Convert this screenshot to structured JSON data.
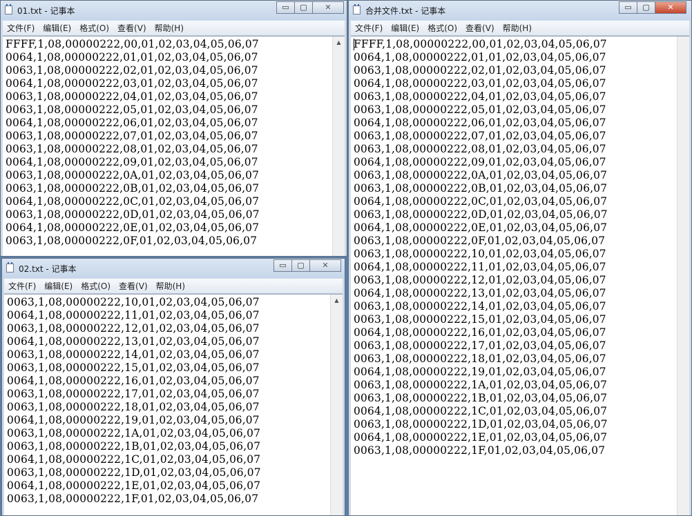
{
  "menu": [
    "文件(F)",
    "编辑(E)",
    "格式(O)",
    "查看(V)",
    "帮助(H)"
  ],
  "window_buttons": {
    "minimize": "▭",
    "maximize": "▢",
    "close": "✕"
  },
  "win1": {
    "title": "01.txt - 记事本",
    "lines": [
      "FFFF,1,08,00000222,00,01,02,03,04,05,06,07",
      "0064,1,08,00000222,01,01,02,03,04,05,06,07",
      "0063,1,08,00000222,02,01,02,03,04,05,06,07",
      "0064,1,08,00000222,03,01,02,03,04,05,06,07",
      "0063,1,08,00000222,04,01,02,03,04,05,06,07",
      "0063,1,08,00000222,05,01,02,03,04,05,06,07",
      "0064,1,08,00000222,06,01,02,03,04,05,06,07",
      "0063,1,08,00000222,07,01,02,03,04,05,06,07",
      "0063,1,08,00000222,08,01,02,03,04,05,06,07",
      "0064,1,08,00000222,09,01,02,03,04,05,06,07",
      "0063,1,08,00000222,0A,01,02,03,04,05,06,07",
      "0063,1,08,00000222,0B,01,02,03,04,05,06,07",
      "0064,1,08,00000222,0C,01,02,03,04,05,06,07",
      "0063,1,08,00000222,0D,01,02,03,04,05,06,07",
      "0064,1,08,00000222,0E,01,02,03,04,05,06,07",
      "0063,1,08,00000222,0F,01,02,03,04,05,06,07"
    ]
  },
  "win2": {
    "title": "02.txt - 记事本",
    "lines": [
      "0063,1,08,00000222,10,01,02,03,04,05,06,07",
      "0064,1,08,00000222,11,01,02,03,04,05,06,07",
      "0063,1,08,00000222,12,01,02,03,04,05,06,07",
      "0064,1,08,00000222,13,01,02,03,04,05,06,07",
      "0063,1,08,00000222,14,01,02,03,04,05,06,07",
      "0063,1,08,00000222,15,01,02,03,04,05,06,07",
      "0064,1,08,00000222,16,01,02,03,04,05,06,07",
      "0063,1,08,00000222,17,01,02,03,04,05,06,07",
      "0063,1,08,00000222,18,01,02,03,04,05,06,07",
      "0064,1,08,00000222,19,01,02,03,04,05,06,07",
      "0063,1,08,00000222,1A,01,02,03,04,05,06,07",
      "0063,1,08,00000222,1B,01,02,03,04,05,06,07",
      "0064,1,08,00000222,1C,01,02,03,04,05,06,07",
      "0063,1,08,00000222,1D,01,02,03,04,05,06,07",
      "0064,1,08,00000222,1E,01,02,03,04,05,06,07",
      "0063,1,08,00000222,1F,01,02,03,04,05,06,07"
    ]
  },
  "win3": {
    "title": "合并文件.txt - 记事本",
    "lines": [
      "FFFF,1,08,00000222,00,01,02,03,04,05,06,07",
      "0064,1,08,00000222,01,01,02,03,04,05,06,07",
      "0063,1,08,00000222,02,01,02,03,04,05,06,07",
      "0064,1,08,00000222,03,01,02,03,04,05,06,07",
      "0063,1,08,00000222,04,01,02,03,04,05,06,07",
      "0063,1,08,00000222,05,01,02,03,04,05,06,07",
      "0064,1,08,00000222,06,01,02,03,04,05,06,07",
      "0063,1,08,00000222,07,01,02,03,04,05,06,07",
      "0063,1,08,00000222,08,01,02,03,04,05,06,07",
      "0064,1,08,00000222,09,01,02,03,04,05,06,07",
      "0063,1,08,00000222,0A,01,02,03,04,05,06,07",
      "0063,1,08,00000222,0B,01,02,03,04,05,06,07",
      "0064,1,08,00000222,0C,01,02,03,04,05,06,07",
      "0063,1,08,00000222,0D,01,02,03,04,05,06,07",
      "0064,1,08,00000222,0E,01,02,03,04,05,06,07",
      "0063,1,08,00000222,0F,01,02,03,04,05,06,07",
      "0063,1,08,00000222,10,01,02,03,04,05,06,07",
      "0064,1,08,00000222,11,01,02,03,04,05,06,07",
      "0063,1,08,00000222,12,01,02,03,04,05,06,07",
      "0064,1,08,00000222,13,01,02,03,04,05,06,07",
      "0063,1,08,00000222,14,01,02,03,04,05,06,07",
      "0063,1,08,00000222,15,01,02,03,04,05,06,07",
      "0064,1,08,00000222,16,01,02,03,04,05,06,07",
      "0063,1,08,00000222,17,01,02,03,04,05,06,07",
      "0063,1,08,00000222,18,01,02,03,04,05,06,07",
      "0064,1,08,00000222,19,01,02,03,04,05,06,07",
      "0063,1,08,00000222,1A,01,02,03,04,05,06,07",
      "0063,1,08,00000222,1B,01,02,03,04,05,06,07",
      "0064,1,08,00000222,1C,01,02,03,04,05,06,07",
      "0063,1,08,00000222,1D,01,02,03,04,05,06,07",
      "0064,1,08,00000222,1E,01,02,03,04,05,06,07",
      "0063,1,08,00000222,1F,01,02,03,04,05,06,07"
    ]
  }
}
